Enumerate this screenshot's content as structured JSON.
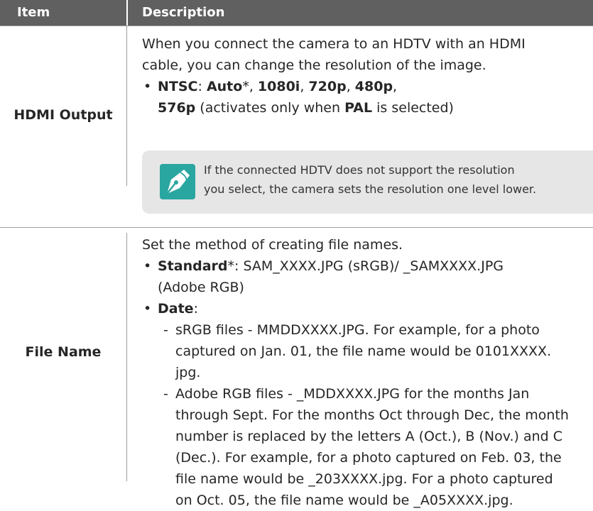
{
  "header": {
    "item": "Item",
    "description": "Description"
  },
  "hdmi": {
    "item": "HDMI Output",
    "line1": "When you connect the camera to an HDTV with an HDMI",
    "line2": "cable, you can change the resolution of the image.",
    "b_ntsc": "NTSC",
    "colon": ": ",
    "b_auto": "Auto",
    "star": "*",
    "comma": ", ",
    "b_1080i": "1080i",
    "b_720p": "720p",
    "b_480p": "480p",
    "trail_comma": ",",
    "b_576p": "576p",
    "activ": " (activates only when ",
    "b_pal": "PAL",
    "selected": " is selected)",
    "note_icon": "note-pen-icon",
    "note_line1": "If the connected HDTV does not support the resolution",
    "note_line2": "you select, the camera sets the resolution one level lower."
  },
  "file": {
    "item": "File Name",
    "line1": "Set the method of creating file names.",
    "b_standard": "Standard",
    "star": "*",
    "standard_rest": ": SAM_XXXX.JPG (sRGB)/ _SAMXXXX.JPG",
    "standard_line2": "(Adobe RGB)",
    "b_date": "Date",
    "colon": ":",
    "srgb_l1": "sRGB files - MMDDXXXX.JPG. For example, for a photo",
    "srgb_l2": "captured on Jan. 01, the file name would be 0101XXXX.",
    "srgb_l3": "jpg.",
    "adobe_l1": "Adobe RGB files - _MDDXXXX.JPG for the months Jan",
    "adobe_l2": "through Sept. For the months Oct through Dec, the month",
    "adobe_l3": "number is replaced by the letters A (Oct.), B (Nov.) and C",
    "adobe_l4": "(Dec.). For example, for a photo captured on Feb. 03, the",
    "adobe_l5": "file name would be _203XXXX.jpg. For a photo captured",
    "adobe_l6": "on Oct. 05, the file name would be _A05XXXX.jpg."
  }
}
